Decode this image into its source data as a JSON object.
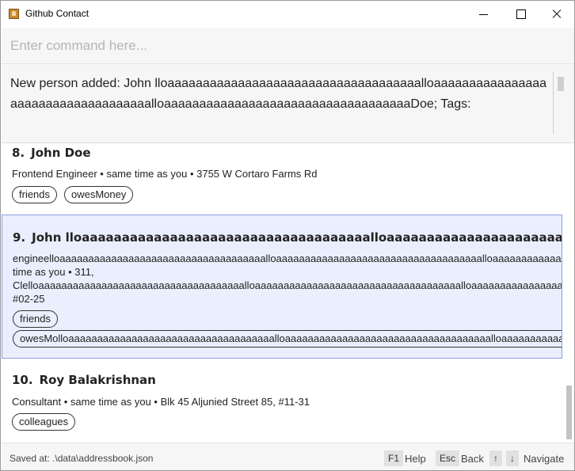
{
  "window": {
    "title": "Github Contact"
  },
  "command": {
    "placeholder": "Enter command here...",
    "value": ""
  },
  "result": {
    "text": "New person added: John lloaaaaaaaaaaaaaaaaaaaaaaaaaaaaaaaaaaaalloaaaaaaaaaaaaaaaaaaaaaaaaaaaaaaaaaaaalloaaaaaaaaaaaaaaaaaaaaaaaaaaaaaaaaaaaDoe; Tags:"
  },
  "persons": [
    {
      "index": "8.",
      "name": "John Doe",
      "info": "Frontend Engineer • same time as you • 3755 W Cortaro Farms Rd",
      "tags": [
        "friends",
        "owesMoney"
      ]
    },
    {
      "index": "9.",
      "name": "John lloaaaaaaaaaaaaaaaaaaaaaaaaaaaaaaaaaaaalloaaaaaaaaaaaaaaaaaaaaaaaaaaaaaaaaaaaalloaaaaaaaaaaaa",
      "info_lines": [
        "engineelloaaaaaaaaaaaaaaaaaaaaaaaaaaaaaaaaaaaalloaaaaaaaaaaaaaaaaaaaaaaaaaaaaaaaaaaaalloaaaaaaaaaaaaaaaaaaaaaaaaaaaaaaaaa",
        "time as you • 311,",
        "Clelloaaaaaaaaaaaaaaaaaaaaaaaaaaaaaaaaaaaalloaaaaaaaaaaaaaaaaaaaaaaaaaaaaaaaaaaaalloaaaaaaaaaaaaaaaaaaaaaaaaaaaaaaaaaaaaa",
        "#02-25"
      ],
      "tags": [
        "friends",
        "owesMolloaaaaaaaaaaaaaaaaaaaaaaaaaaaaaaaaaaaalloaaaaaaaaaaaaaaaaaaaaaaaaaaaaaaaaaaaalloaaaaaaaaaaaaaaaaaaaaaaa"
      ],
      "selected": true
    },
    {
      "index": "10.",
      "name": "Roy Balakrishnan",
      "info": "Consultant • same time as you • Blk 45 Aljunied Street 85, #11-31",
      "tags": [
        "colleagues"
      ]
    }
  ],
  "statusbar": {
    "saved_path": "Saved at: .\\data\\addressbook.json",
    "keys": [
      {
        "key": "F1",
        "label": "Help"
      },
      {
        "key": "Esc",
        "label": "Back"
      },
      {
        "key": "↑",
        "label": ""
      },
      {
        "key": "↓",
        "label": "Navigate"
      }
    ]
  },
  "colors": {
    "selected_bg": "#e9effd",
    "selected_border": "#8e9be0",
    "panel_bg": "#f6f6f6"
  }
}
